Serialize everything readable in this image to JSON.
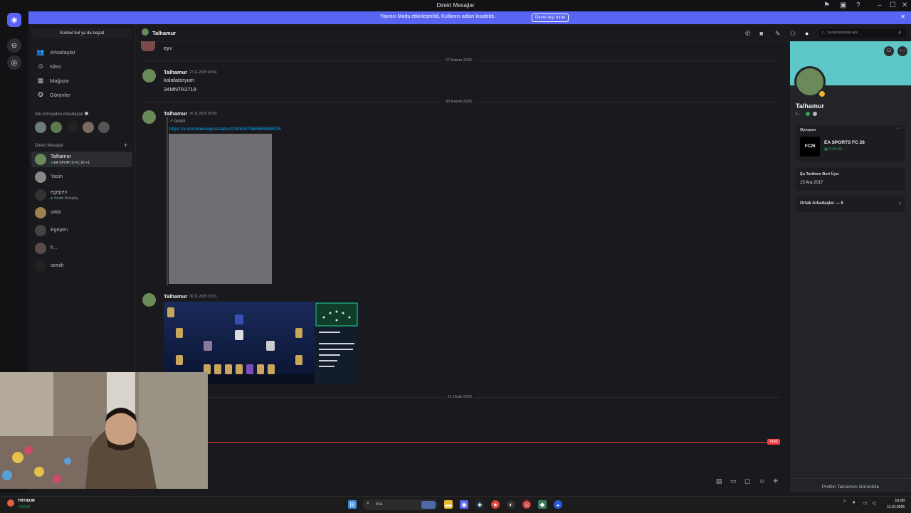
{
  "window": {
    "title": "Direkt Mesajlar",
    "minimize": "–",
    "maximize": "☐",
    "close": "✕"
  },
  "banner": {
    "message": "Yayıncı Modu etkinleştirildi. Kullanıcı adları kısaltıldı.",
    "button": "Devre dışı bırak",
    "close": "✕"
  },
  "sidebar": {
    "search_placeholder": "Sohbet bul ya da başlat",
    "nav": [
      {
        "label": "Arkadaşlar",
        "icon": "friends-icon"
      },
      {
        "label": "Nitro",
        "icon": "nitro-icon"
      },
      {
        "label": "Mağaza",
        "icon": "shop-icon"
      },
      {
        "label": "Görevler",
        "icon": "quests-icon"
      }
    ],
    "frequent_label": "Sık Görüşülen Arkadaşlar",
    "dm_label": "Direkt Mesajlar",
    "add": "+",
    "dms": [
      {
        "name": "Talhamur",
        "sub": "EA SPORTS FC 26 +1",
        "active": true
      },
      {
        "name": "Yasin",
        "sub": ""
      },
      {
        "name": "egepen",
        "sub": "Yeralti Roleplay"
      },
      {
        "name": "s4do",
        "sub": ""
      },
      {
        "name": "Egepen",
        "sub": ""
      },
      {
        "name": "h...",
        "sub": ""
      },
      {
        "name": "semih",
        "sub": ""
      }
    ]
  },
  "header": {
    "name": "Talhamur",
    "search_placeholder": "r... sunucusunda ara"
  },
  "messages": {
    "top_text": "eyv",
    "date1": "27 Kasım 2025",
    "m1_name": "Talhamur",
    "m1_time": "27.11.2025 00:04",
    "m1_line1": "kalafatoryum",
    "m1_line2": "34MNTA3719",
    "date2": "30 Kasım 2025",
    "m2_name": "Talhamur",
    "m2_time": "30.11.2025 00:03",
    "m2_forwarded": "İletildi",
    "m2_link": "https://x.com/raionagss/status/1905347968669986976",
    "m3_name": "Talhamur",
    "m3_time": "30.11.2025 23:01",
    "date3": "11 Ocak 2026",
    "new_label": "YENİ"
  },
  "profile": {
    "name": "Talhamur",
    "tag": "r...",
    "playing_label": "Oynuyor",
    "game_title": "EA SPORTS FC 26",
    "game_time": "2:08:09",
    "game_logo_text": "FC26",
    "member_since_label": "Şu Tarihten Beri Üye:",
    "member_since": "15 Ara 2017",
    "mutual_friends": "Ortak Arkadaşlar — 6",
    "view_full": "Profilin Tamamını Görüntüle",
    "more": "···"
  },
  "taskbar": {
    "currency": "TRY/EUR",
    "change": "+%0,50",
    "search": "Ara",
    "time": "16:08",
    "date": "11.01.2026"
  },
  "colors": {
    "accent": "#5865f2",
    "online": "#23a55a",
    "link": "#00a8fc",
    "new_line": "#f23f42",
    "banner_teal": "#5ec8c8"
  }
}
